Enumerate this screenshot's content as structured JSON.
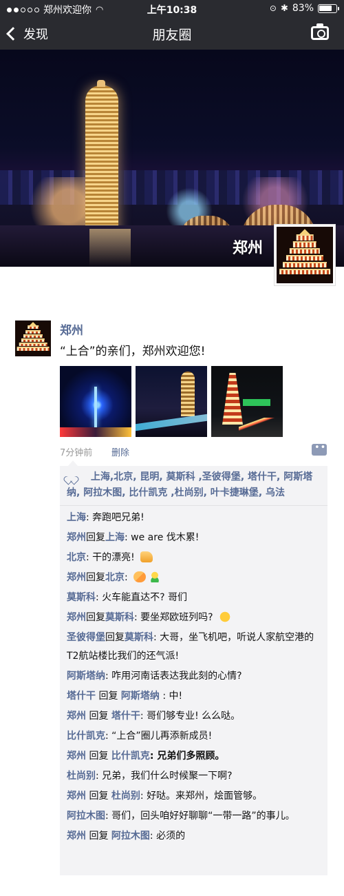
{
  "status": {
    "carrier": "郑州欢迎你",
    "time": "上午10:38",
    "battery": "83%",
    "battery_level": 0.83
  },
  "nav": {
    "back_label": "发现",
    "title": "朋友圈"
  },
  "cover": {
    "name": "郑州"
  },
  "post": {
    "author": "郑州",
    "text": "“上合”的亲们，郑州欢迎您!",
    "time": "7分钟前",
    "delete_label": "删除"
  },
  "likes": [
    "上海",
    ",北京",
    ", 昆明",
    ", 莫斯科",
    " ,圣彼得堡",
    ", 塔什干",
    ", 阿斯塔纳",
    ", 阿拉木图",
    ", 比什凯克",
    " ,杜尚别",
    ", 叶卡捷琳堡",
    ", 乌法"
  ],
  "comments": [
    {
      "from": "上海",
      "to": "",
      "text": ": 奔跑吧兄弟!"
    },
    {
      "from": "郑州",
      "reply": "回复",
      "to": "上海",
      "text": ": we are 伐木累!"
    },
    {
      "from": "北京",
      "to": "",
      "text": ": 干的漂亮! ",
      "icon": "thumbs-up-icon"
    },
    {
      "from": "郑州",
      "reply": "回复",
      "to": "北京",
      "text": ": ",
      "icon": "handshake-icon",
      "icon2": "cheers-icon"
    },
    {
      "from": "莫斯科",
      "to": "",
      "text": ": 火车能直达不? 哥们"
    },
    {
      "from": "郑州",
      "reply": "回复",
      "to": "莫斯科",
      "text": ": 要坐郑欧班列吗? ",
      "icon": "thinking-face-icon"
    },
    {
      "from": "圣彼得堡",
      "reply": "回复",
      "to": "莫斯科",
      "text": ": 大哥，坐飞机吧，听说人家航空港的T2航站楼比我们的还气派!"
    },
    {
      "from": "阿斯塔纳",
      "to": "",
      "text": ": 咋用河南话表达我此刻的心情?"
    },
    {
      "from": "塔什干",
      "reply": " 回复 ",
      "to": "阿斯塔纳",
      "text": " :  中!"
    },
    {
      "from": "郑州",
      "reply": " 回复 ",
      "to": "塔什干",
      "text": ": 哥们够专业! 么么哒。"
    },
    {
      "from": "比什凯克",
      "to": "",
      "text": ": “上合”圈儿再添新成员!"
    },
    {
      "from": "郑州",
      "reply": " 回复 ",
      "to": "比什凯克",
      "text": ": 兄弟们多照顾。",
      "bold": true
    },
    {
      "from": "杜尚别",
      "to": "",
      "text": ": 兄弟，我们什么时候聚一下啊?"
    },
    {
      "from": "郑州",
      "reply": " 回复 ",
      "to": "杜尚别",
      "text": ": 好哒。来郑州，烩面管够。"
    },
    {
      "from": "阿拉木图",
      "to": "",
      "text": ": 哥们，回头咱好好聊聊“一带一路”的事儿。"
    },
    {
      "from": "郑州",
      "reply": " 回复 ",
      "to": "阿拉木图",
      "text": ": 必须的"
    }
  ]
}
